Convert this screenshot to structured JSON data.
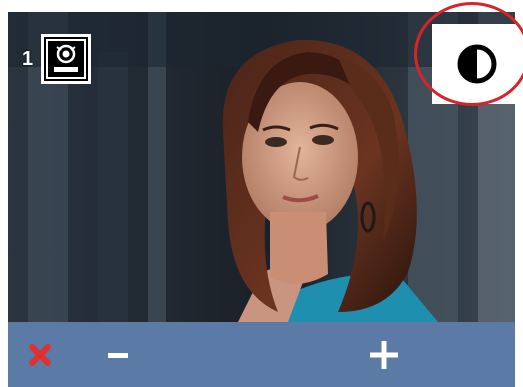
{
  "camera": {
    "number": "1",
    "icon": "doorbell-camera-icon"
  },
  "contrast_button": {
    "icon": "contrast-icon"
  },
  "toolbar": {
    "close_icon": "close-x-icon",
    "minus_icon": "minus-icon",
    "plus_icon": "plus-icon"
  },
  "colors": {
    "toolbar_bg": "#5b7aa6",
    "close_red": "#e03030",
    "highlight_red": "#d8232a"
  }
}
